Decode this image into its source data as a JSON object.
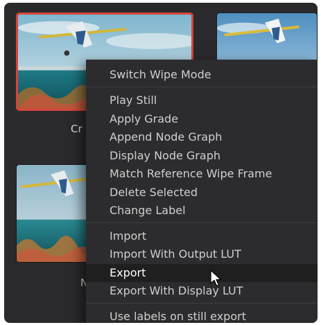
{
  "gallery": {
    "captions": [
      "Cr",
      "N"
    ]
  },
  "context_menu": {
    "items": [
      {
        "label": "Switch Wipe Mode"
      },
      {
        "label": "Play Still"
      },
      {
        "label": "Apply Grade"
      },
      {
        "label": "Append Node Graph"
      },
      {
        "label": "Display Node Graph"
      },
      {
        "label": "Match Reference Wipe Frame"
      },
      {
        "label": "Delete Selected"
      },
      {
        "label": "Change Label"
      },
      {
        "label": "Import"
      },
      {
        "label": "Import With Output LUT"
      },
      {
        "label": "Export"
      },
      {
        "label": "Export With Display LUT"
      },
      {
        "label": "Use labels on still export"
      }
    ],
    "hovered_item": "Export"
  },
  "colors": {
    "background": "#2a2a2c",
    "menu": "#2c2c2f",
    "selection_border": "#d7443b",
    "hover_row": "#1f1f20"
  }
}
